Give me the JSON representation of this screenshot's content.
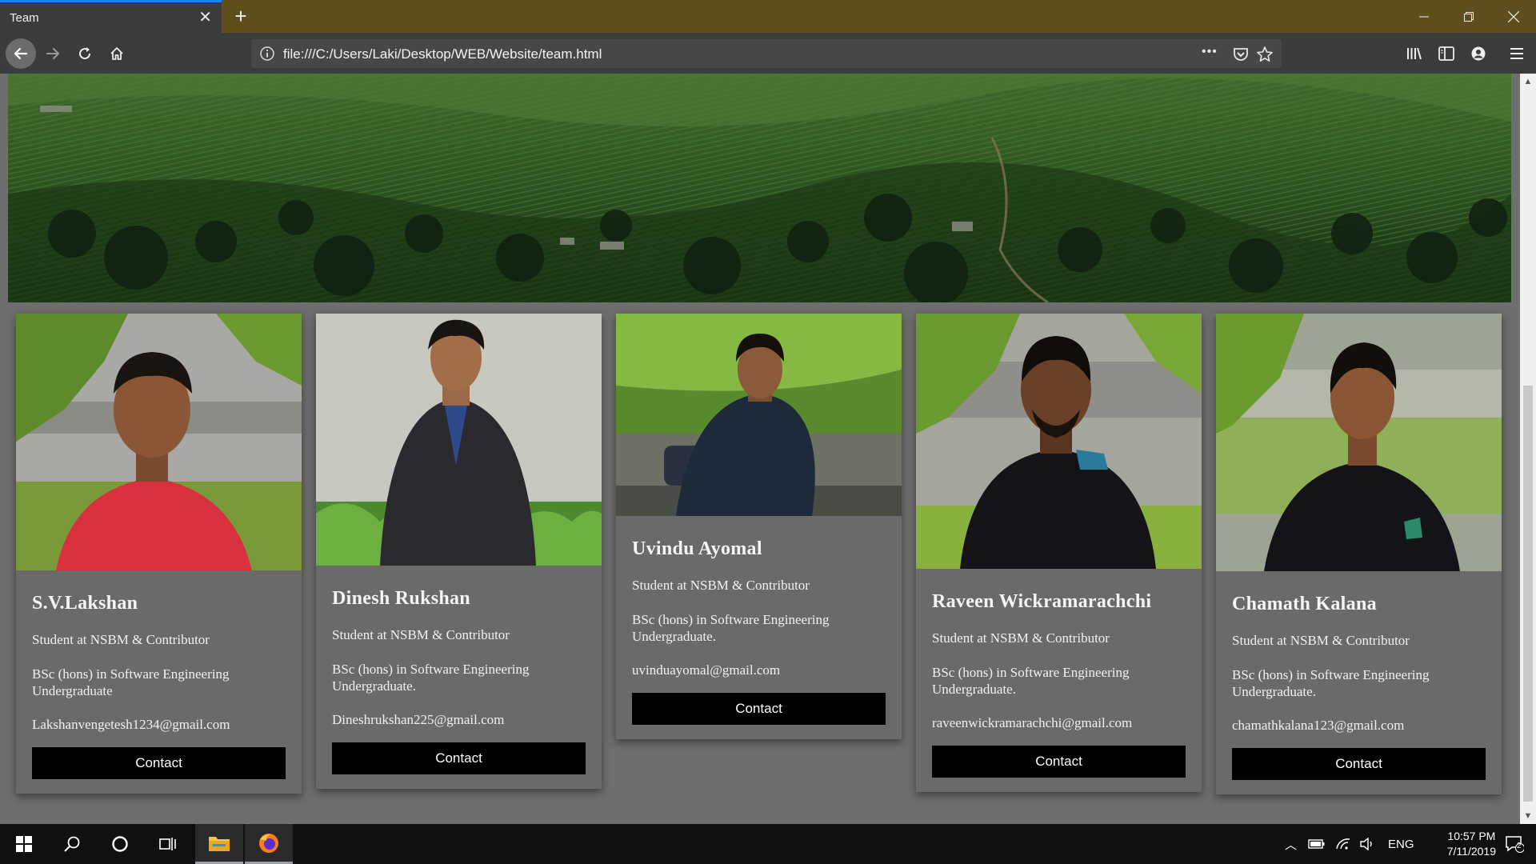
{
  "browser": {
    "tab_title": "Team",
    "tab_close": "✕",
    "new_tab": "+",
    "url": "file:///C:/Users/Laki/Desktop/WEB/Website/team.html",
    "url_more": "•••"
  },
  "cards": [
    {
      "name": "S.V.Lakshan",
      "role": "Student at NSBM & Contributor",
      "degree": "BSc (hons) in Software Engineering Undergraduate",
      "email": "Lakshanvengetesh1234@gmail.com",
      "button": "Contact",
      "shirt_color": "#d8303c"
    },
    {
      "name": "Dinesh Rukshan",
      "role": "Student at NSBM & Contributor",
      "degree": "BSc (hons) in Software Engineering Undergraduate.",
      "email": "Dineshrukshan225@gmail.com",
      "button": "Contact",
      "shirt_color": "#2a2a2e"
    },
    {
      "name": "Uvindu Ayomal",
      "role": "Student at NSBM & Contributor",
      "degree": "BSc (hons) in Software Engineering Undergraduate.",
      "email": "uvinduayomal@gmail.com",
      "button": "Contact",
      "shirt_color": "#1c2a3a"
    },
    {
      "name": "Raveen Wickramarachchi",
      "role": "Student at NSBM & Contributor",
      "degree": "BSc (hons) in Software Engineering Undergraduate.",
      "email": "raveenwickramarachchi@gmail.com",
      "button": "Contact",
      "shirt_color": "#141418"
    },
    {
      "name": "Chamath Kalana",
      "role": "Student at NSBM & Contributor",
      "degree": "BSc (hons) in Software Engineering Undergraduate.",
      "email": "chamathkalana123@gmail.com",
      "button": "Contact",
      "shirt_color": "#141418"
    }
  ],
  "taskbar": {
    "language": "ENG",
    "time": "10:57 PM",
    "date": "7/11/2019",
    "notification_count": "2"
  },
  "colors": {
    "titlebar": "#5e4e1e",
    "toolbar": "#3b3b3c",
    "page_background": "#6e6e6e",
    "button": "#000000"
  }
}
